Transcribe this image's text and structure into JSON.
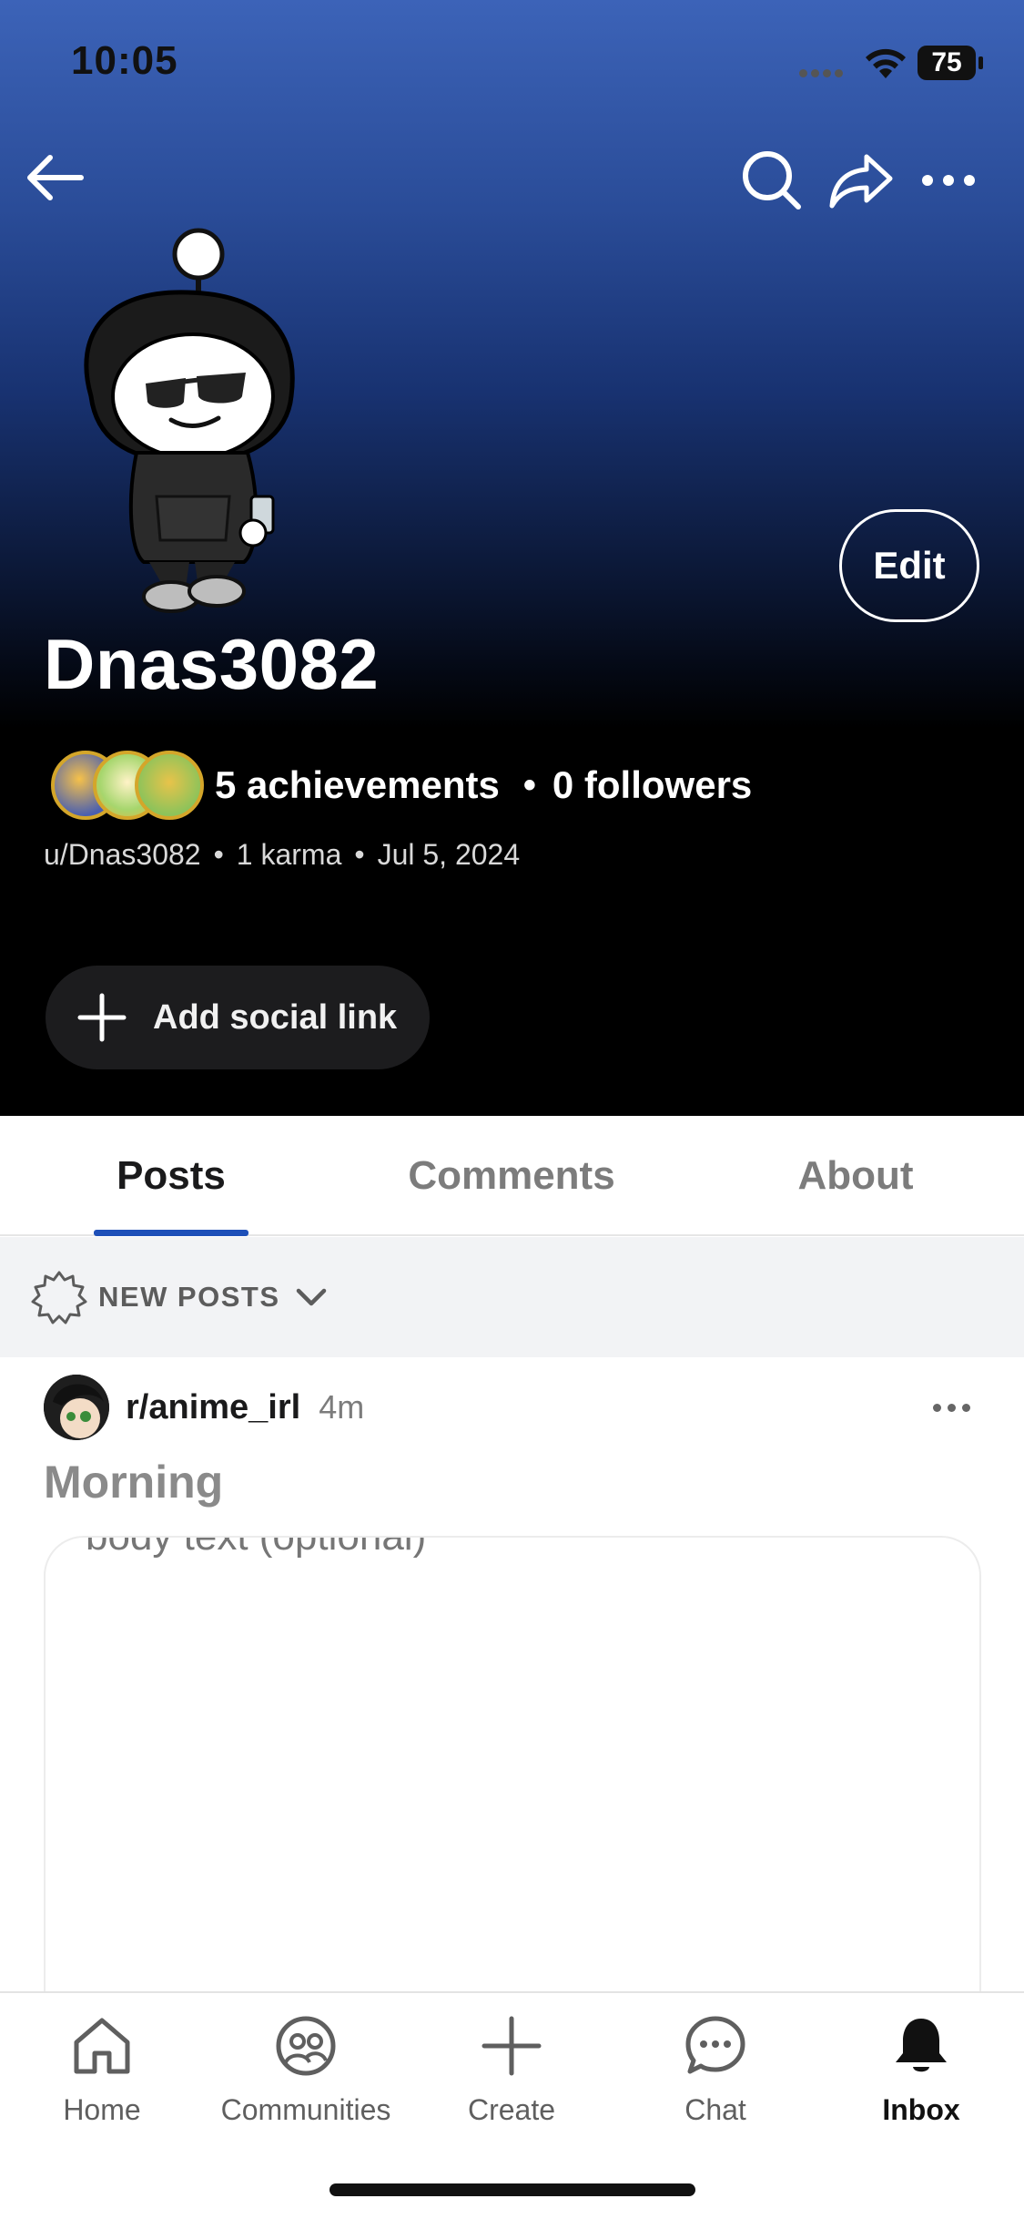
{
  "status_bar": {
    "time": "10:05",
    "battery": "75"
  },
  "header": {
    "back_icon": "back-arrow-icon",
    "search_icon": "search-icon",
    "share_icon": "share-icon",
    "more_icon": "more-horizontal-icon"
  },
  "profile": {
    "edit_label": "Edit",
    "username": "Dnas3082",
    "achievements": "5 achievements",
    "followers": "0 followers",
    "handle": "u/Dnas3082",
    "karma": "1 karma",
    "joined": "Jul 5, 2024",
    "social_link_label": "Add social link"
  },
  "tabs": [
    {
      "label": "Posts",
      "active": true
    },
    {
      "label": "Comments",
      "active": false
    },
    {
      "label": "About",
      "active": false
    }
  ],
  "sort": {
    "label": "NEW POSTS"
  },
  "post": {
    "subreddit": "r/anime_irl",
    "time": "4m",
    "title": "Morning",
    "body_placeholder": "body text (optional)"
  },
  "bottom_nav": [
    {
      "label": "Home",
      "icon": "home-icon",
      "active": false
    },
    {
      "label": "Communities",
      "icon": "communities-icon",
      "active": false
    },
    {
      "label": "Create",
      "icon": "plus-icon",
      "active": false
    },
    {
      "label": "Chat",
      "icon": "chat-icon",
      "active": false
    },
    {
      "label": "Inbox",
      "icon": "bell-icon",
      "active": true
    }
  ],
  "colors": {
    "tab_underline": "#1d4fb8",
    "header_gradient_top": "#3c63b8",
    "header_gradient_bottom": "#000000"
  }
}
